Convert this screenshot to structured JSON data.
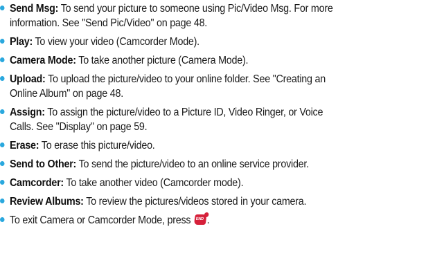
{
  "options": [
    {
      "term": "Send Msg:",
      "desc": "To send your picture to someone using Pic/Video Msg. For more information. See \"Send Pic/Video\" on page 48.",
      "lines": [
        "To send your picture to someone using Pic/Video Msg. For more",
        "information. See \"Send Pic/Video\" on page 48."
      ]
    },
    {
      "term": "Play:",
      "lines": [
        "To view your video (Camcorder Mode)."
      ]
    },
    {
      "term": "Camera Mode:",
      "lines": [
        "To take another picture (Camera Mode)."
      ]
    },
    {
      "term": "Upload:",
      "lines": [
        "To upload the picture/video to your online folder. See \"Creating an",
        "Online Album\" on page 48."
      ]
    },
    {
      "term": "Assign:",
      "lines": [
        "To assign the picture/video to a Picture ID, Video Ringer, or Voice",
        "Calls. See \"Display\" on page 59."
      ]
    },
    {
      "term": "Erase:",
      "lines": [
        "To erase this picture/video."
      ]
    },
    {
      "term": "Send to Other:",
      "lines": [
        "To send the picture/video to an online service provider."
      ]
    },
    {
      "term": "Camcorder:",
      "lines": [
        "To take another video (Camcorder mode)."
      ]
    },
    {
      "term": "Review Albums:",
      "lines": [
        "To review the pictures/videos stored in your camera."
      ]
    }
  ],
  "exit_note": {
    "text": "To exit Camera or Camcorder Mode, press",
    "key_label": "END",
    "key_icon": "end-key-icon",
    "suffix": "."
  },
  "colors": {
    "bullet": "#2aa8de",
    "end_key": "#d6203a"
  }
}
